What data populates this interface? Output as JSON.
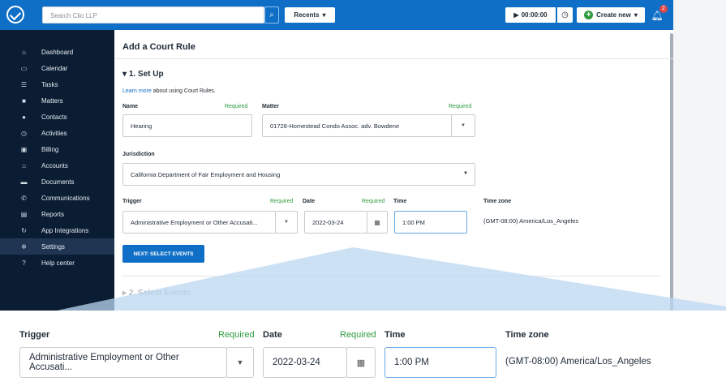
{
  "topbar": {
    "search_placeholder": "Search Clio LLP",
    "search_icon": "search-icon",
    "recents_label": "Recents",
    "timer_label": "00:00:00",
    "create_label": "Create new",
    "notification_count": "2",
    "brand_color": "#0f6fc6"
  },
  "sidebar": {
    "items": [
      {
        "label": "Dashboard",
        "icon": "home-icon",
        "glyph": "⌂"
      },
      {
        "label": "Calendar",
        "icon": "calendar-icon",
        "glyph": "▭"
      },
      {
        "label": "Tasks",
        "icon": "tasks-icon",
        "glyph": "☰"
      },
      {
        "label": "Matters",
        "icon": "briefcase-icon",
        "glyph": "■"
      },
      {
        "label": "Contacts",
        "icon": "user-icon",
        "glyph": "●"
      },
      {
        "label": "Activities",
        "icon": "clock-icon",
        "glyph": "◷"
      },
      {
        "label": "Billing",
        "icon": "billing-icon",
        "glyph": "▣"
      },
      {
        "label": "Accounts",
        "icon": "bank-icon",
        "glyph": "⌂"
      },
      {
        "label": "Documents",
        "icon": "folder-icon",
        "glyph": "▬"
      },
      {
        "label": "Communications",
        "icon": "phone-icon",
        "glyph": "✆"
      },
      {
        "label": "Reports",
        "icon": "chart-icon",
        "glyph": "▤"
      },
      {
        "label": "App Integrations",
        "icon": "sync-icon",
        "glyph": "↻"
      },
      {
        "label": "Settings",
        "icon": "gear-icon",
        "glyph": "✲"
      },
      {
        "label": "Help center",
        "icon": "help-icon",
        "glyph": "?"
      }
    ]
  },
  "main": {
    "page_title": "Add a Court Rule",
    "section1_title": "1. Set Up",
    "learn_link": "Learn more",
    "learn_rest": "about using Court Rules.",
    "name_label": "Name",
    "required_text": "Required",
    "name_value": "Hearing",
    "matter_label": "Matter",
    "matter_value": "01728-Homestead Condo Assoc. adv. Bowdene",
    "jurisdiction_label": "Jurisdiction",
    "jurisdiction_value": "California Department of Fair Employment and Housing",
    "trigger_label": "Trigger",
    "trigger_value": "Administrative Employment or Other Accusati...",
    "date_label": "Date",
    "date_value": "2022-03-24",
    "time_label": "Time",
    "time_value": "1:00 PM",
    "timezone_label": "Time zone",
    "timezone_value": "(GMT-08:00) America/Los_Angeles",
    "next_button": "NEXT: SELECT EVENTS",
    "section2_title": "2. Select Events"
  }
}
